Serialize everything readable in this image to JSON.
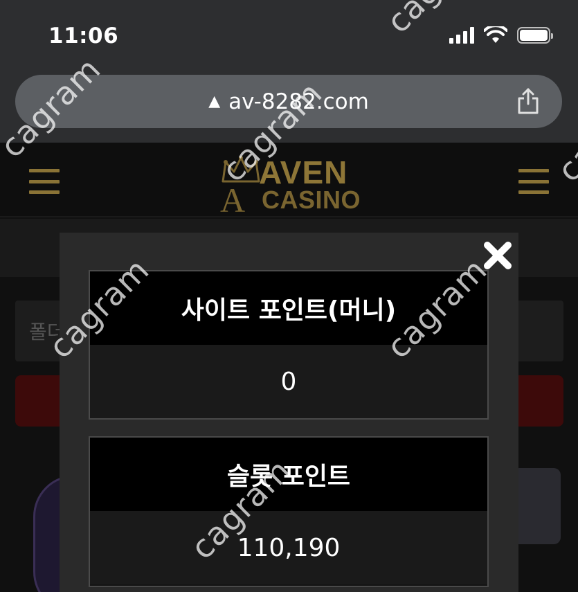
{
  "status_bar": {
    "time": "11:06"
  },
  "browser": {
    "url": "av-8282.com",
    "warning_icon": "warning-triangle-icon",
    "share_icon": "share-icon"
  },
  "site": {
    "logo_line1": "AVEN",
    "logo_line2": "CASINO",
    "logo_letter": "A",
    "bg_card_label": "폴더"
  },
  "modal": {
    "close_icon": "close-icon",
    "boxes": [
      {
        "title": "사이트 포인트(머니)",
        "value": "0"
      },
      {
        "title": "슬롯 포인트",
        "value": "110,190"
      }
    ]
  },
  "watermark": "cagram",
  "colors": {
    "gold": "#8e7637",
    "modal_bg": "#2a2a2a",
    "header_bg": "#000000",
    "accent_red": "#3d0a0a"
  }
}
